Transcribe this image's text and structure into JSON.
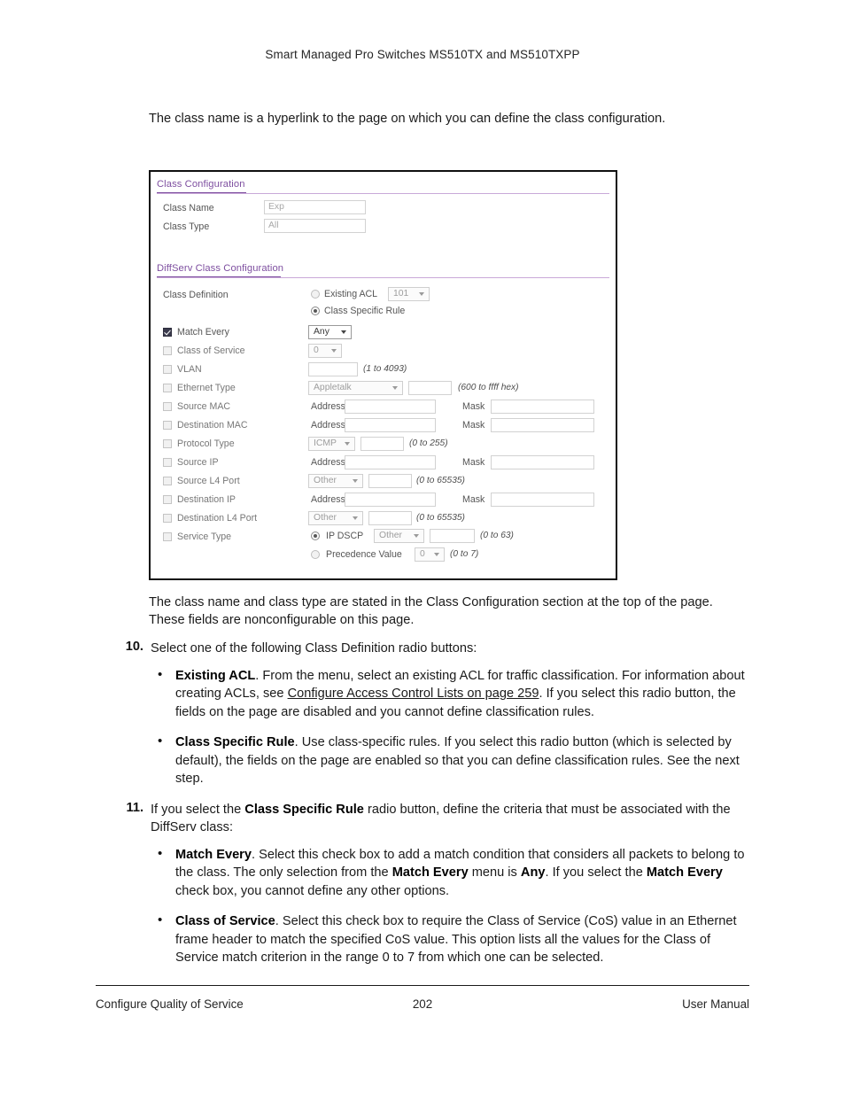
{
  "running_head": "Smart Managed Pro Switches MS510TX and MS510TXPP",
  "intro_paragraph": "The class name is a hyperlink to the page on which you can define the class configuration.",
  "figure": {
    "sections": {
      "class_configuration": "Class Configuration",
      "diffserv_class_configuration": "DiffServ Class Configuration"
    },
    "class_config_fields": [
      {
        "label": "Class Name",
        "value": "Exp"
      },
      {
        "label": "Class Type",
        "value": "All"
      }
    ],
    "class_definition": {
      "label": "Class Definition",
      "options": [
        {
          "label": "Existing ACL",
          "selected": false,
          "select_value": "101"
        },
        {
          "label": "Class Specific Rule",
          "selected": true
        }
      ]
    },
    "criteria_rows": [
      {
        "label": "Match Every",
        "checked": true,
        "select_value": "Any"
      },
      {
        "label": "Class of Service",
        "checked": false,
        "select_value": "0"
      },
      {
        "label": "VLAN",
        "checked": false,
        "hint": "(1 to 4093)"
      },
      {
        "label": "Ethernet Type",
        "checked": false,
        "select_value": "Appletalk",
        "hint": "(600 to ffff hex)"
      },
      {
        "label": "Source MAC",
        "checked": false,
        "sub1": "Address",
        "sub2": "Mask"
      },
      {
        "label": "Destination MAC",
        "checked": false,
        "sub1": "Address",
        "sub2": "Mask"
      },
      {
        "label": "Protocol Type",
        "checked": false,
        "select_value": "ICMP",
        "hint": "(0 to 255)"
      },
      {
        "label": "Source IP",
        "checked": false,
        "sub1": "Address",
        "sub2": "Mask"
      },
      {
        "label": "Source L4 Port",
        "checked": false,
        "select_value": "Other",
        "hint": "(0 to 65535)"
      },
      {
        "label": "Destination IP",
        "checked": false,
        "sub1": "Address",
        "sub2": "Mask"
      },
      {
        "label": "Destination L4 Port",
        "checked": false,
        "select_value": "Other",
        "hint": "(0 to 65535)"
      },
      {
        "label": "Service Type",
        "checked": false
      }
    ],
    "service_type_options": [
      {
        "label": "IP DSCP",
        "selected": true,
        "select_value": "Other",
        "hint": "(0 to 63)"
      },
      {
        "label": "Precedence Value",
        "selected": false,
        "select_value": "0",
        "hint": "(0 to 7)"
      }
    ],
    "accent_color": "#7e4fa0"
  },
  "after_figure_paragraph": "The class name and class type are stated in the Class Configuration section at the top of the page. These fields are nonconfigurable on this page.",
  "steps": [
    {
      "number": "10.",
      "text": "Select one of the following Class Definition radio buttons:",
      "bullets": [
        {
          "term": "Existing ACL",
          "text_before_link": ". From the menu, select an existing ACL for traffic classification. For information about creating ACLs, see ",
          "link": "Configure Access Control Lists on page 259",
          "text_after_link": ". If you select this radio button, the fields on the page are disabled and you cannot define classification rules."
        },
        {
          "term": "Class Specific Rule",
          "text_before_link": ". Use class-specific rules. If you select this radio button (which is selected by default), the fields on the page are enabled so that you can define classification rules. See the next step.",
          "link": "",
          "text_after_link": ""
        }
      ]
    },
    {
      "number": "11.",
      "text_part1": "If you select the ",
      "text_bold1": "Class Specific Rule",
      "text_part2": " radio button, define the criteria that must be associated with the DiffServ class:",
      "bullets": [
        {
          "term": "Match Every",
          "seg1": ". Select this check box to add a match condition that considers all packets to belong to the class. The only selection from the ",
          "bold2": "Match Every",
          "seg2": " menu is ",
          "bold3": "Any",
          "seg3": ". If you select the ",
          "bold4": "Match Every",
          "seg4": " check box, you cannot define any other options."
        },
        {
          "term": "Class of Service",
          "seg1": ". Select this check box to require the Class of Service (CoS) value in an Ethernet frame header to match the specified CoS value. This option lists all the values for the Class of Service match criterion in the range 0 to 7 from which one can be selected."
        }
      ]
    }
  ],
  "footer": {
    "left": "Configure Quality of Service",
    "center": "202",
    "right": "User Manual"
  }
}
